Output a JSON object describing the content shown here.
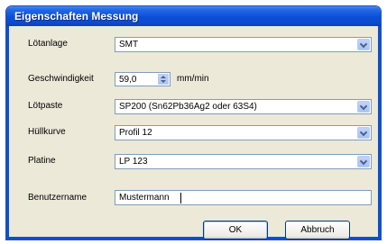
{
  "window": {
    "title": "Eigenschaften Messung"
  },
  "form": {
    "loetanlage": {
      "label": "Lötanlage",
      "value": "SMT"
    },
    "geschwindigkeit": {
      "label": "Geschwindigkeit",
      "value": "59,0",
      "unit": "mm/min"
    },
    "loetpaste": {
      "label": "Lötpaste",
      "value": "SP200 (Sn62Pb36Ag2 oder 63S4)"
    },
    "huellkurve": {
      "label": "Hüllkurve",
      "value": "Profil 12"
    },
    "platine": {
      "label": "Platine",
      "value": "LP 123"
    },
    "benutzername": {
      "label": "Benutzername",
      "value": "Mustermann"
    }
  },
  "buttons": {
    "ok": "OK",
    "cancel": "Abbruch"
  }
}
